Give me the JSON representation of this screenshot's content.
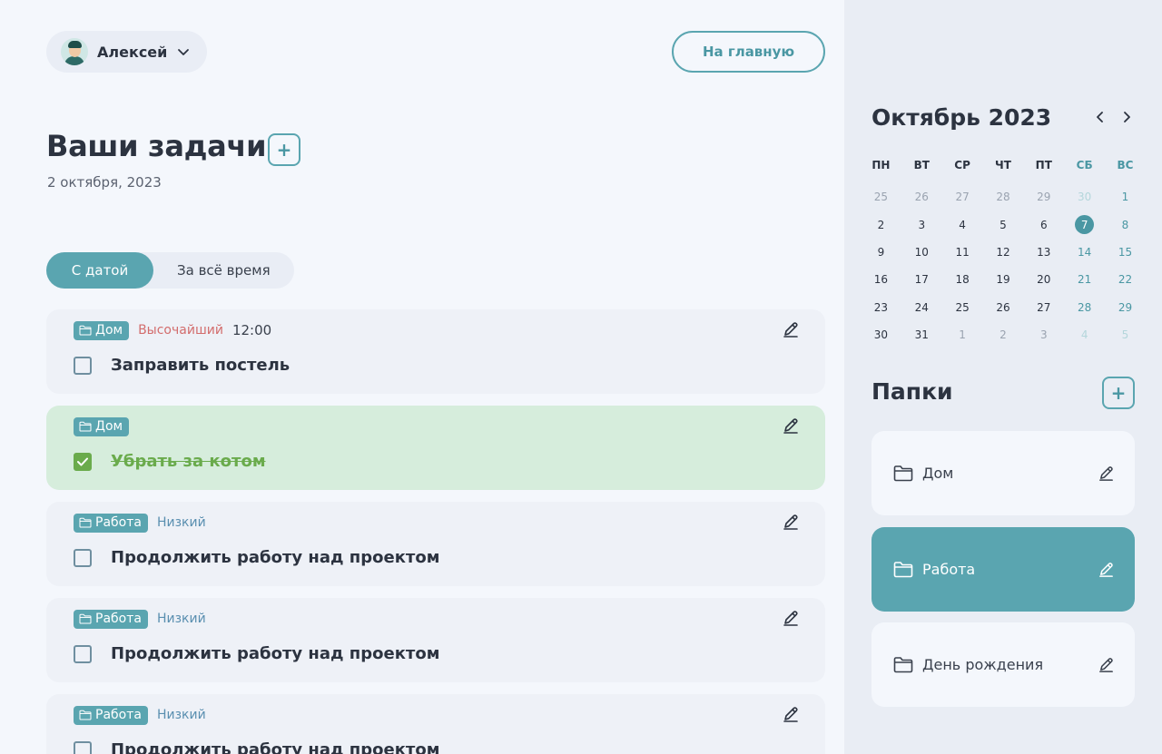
{
  "user": {
    "name": "Алексей",
    "avatar_icon": "avatar-icon"
  },
  "header": {
    "home_button": "На главную"
  },
  "page": {
    "title": "Ваши задачи",
    "add_label": "+",
    "date": "2 октября, 2023"
  },
  "filter": {
    "options": [
      "С датой",
      "За всё время"
    ],
    "active": "С датой"
  },
  "tasks": [
    {
      "folder": "Дом",
      "priority": "Высочайший",
      "priority_level": "high",
      "time": "12:00",
      "text": "Заправить постель",
      "done": false
    },
    {
      "folder": "Дом",
      "priority": "",
      "priority_level": "",
      "time": "",
      "text": "Убрать за котом",
      "done": true
    },
    {
      "folder": "Работа",
      "priority": "Низкий",
      "priority_level": "low",
      "time": "",
      "text": "Продолжить работу над проектом",
      "done": false
    },
    {
      "folder": "Работа",
      "priority": "Низкий",
      "priority_level": "low",
      "time": "",
      "text": "Продолжить работу над проектом",
      "done": false
    },
    {
      "folder": "Работа",
      "priority": "Низкий",
      "priority_level": "low",
      "time": "",
      "text": "Продолжить работу над проектом",
      "done": false
    }
  ],
  "calendar": {
    "month": "Октябрь 2023",
    "weekdays": [
      "ПН",
      "ВТ",
      "СР",
      "ЧТ",
      "ПТ",
      "СБ",
      "ВС"
    ],
    "weeks": [
      [
        "25",
        "26",
        "27",
        "28",
        "29",
        "30",
        "1"
      ],
      [
        "2",
        "3",
        "4",
        "5",
        "6",
        "7",
        "8"
      ],
      [
        "9",
        "10",
        "11",
        "12",
        "13",
        "14",
        "15"
      ],
      [
        "16",
        "17",
        "18",
        "19",
        "20",
        "21",
        "22"
      ],
      [
        "23",
        "24",
        "25",
        "26",
        "27",
        "28",
        "29"
      ],
      [
        "30",
        "31",
        "1",
        "2",
        "3",
        "4",
        "5"
      ]
    ],
    "today": "7"
  },
  "folders": {
    "title": "Папки",
    "add_label": "+",
    "items": [
      {
        "name": "Дом",
        "active": false
      },
      {
        "name": "Работа",
        "active": true
      },
      {
        "name": "День рождения",
        "active": false
      }
    ]
  },
  "colors": {
    "accent": "#5aa5b0",
    "done_bg": "#d6eddc",
    "done_text": "#6aab4c",
    "high_priority": "#d36d6d",
    "low_priority": "#5a8fb0"
  }
}
